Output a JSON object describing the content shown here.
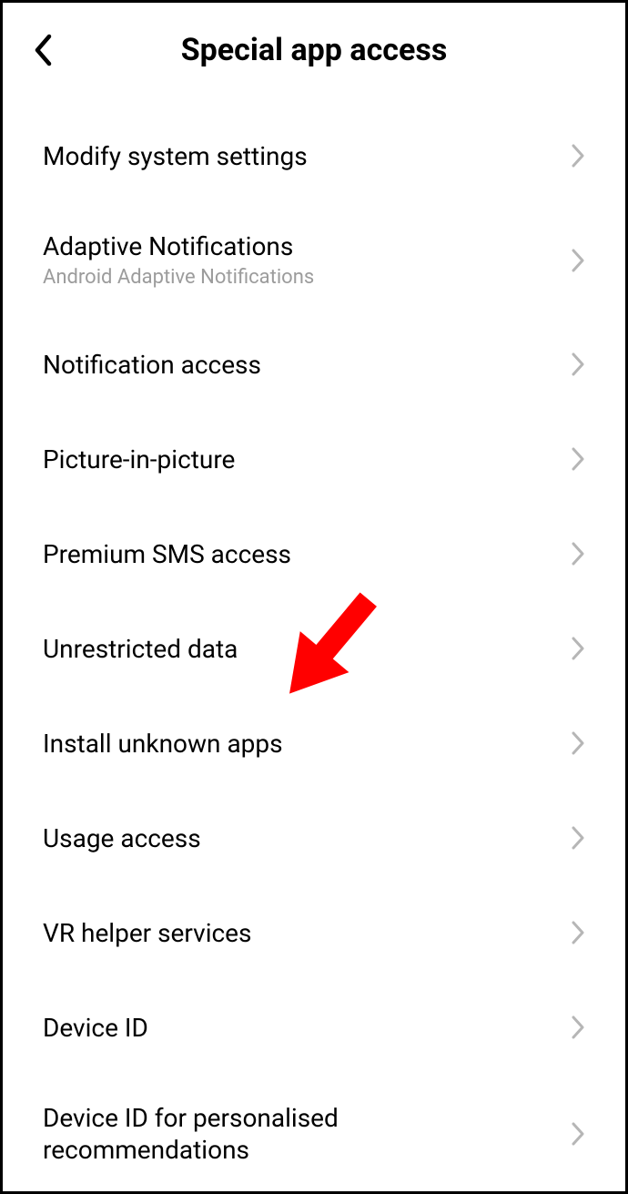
{
  "header": {
    "title": "Special app access"
  },
  "items": [
    {
      "label": "Modify system settings",
      "sub": null
    },
    {
      "label": "Adaptive Notifications",
      "sub": "Android Adaptive Notifications"
    },
    {
      "label": "Notification access",
      "sub": null
    },
    {
      "label": "Picture-in-picture",
      "sub": null
    },
    {
      "label": "Premium SMS access",
      "sub": null
    },
    {
      "label": "Unrestricted data",
      "sub": null
    },
    {
      "label": "Install unknown apps",
      "sub": null
    },
    {
      "label": "Usage access",
      "sub": null
    },
    {
      "label": "VR helper services",
      "sub": null
    },
    {
      "label": "Device ID",
      "sub": null
    },
    {
      "label": "Device ID for personalised recommendations",
      "sub": null
    }
  ],
  "annotation": {
    "type": "red-arrow",
    "points_to_item_index": 6
  }
}
